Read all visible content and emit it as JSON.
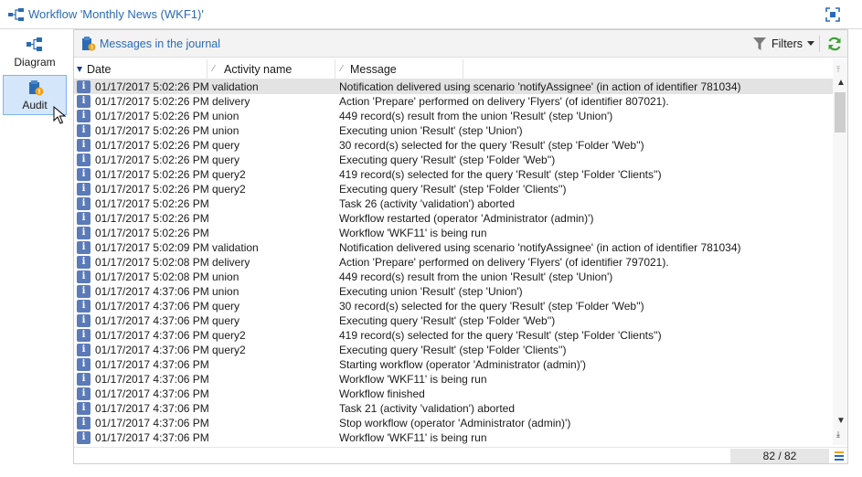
{
  "window": {
    "title": "Workflow 'Monthly News (WKF1)'",
    "icons": {
      "workflow": "workflow-icon",
      "maximize": "maximize-icon"
    }
  },
  "sidebar": {
    "items": [
      {
        "label": "Diagram",
        "icon": "diagram-icon",
        "active": false
      },
      {
        "label": "Audit",
        "icon": "audit-icon",
        "active": true
      }
    ]
  },
  "journal": {
    "title": "Messages in the journal",
    "icon": "journal-icon",
    "filters_label": "Filters",
    "refresh_icon": "refresh-icon"
  },
  "table": {
    "columns": [
      "Date",
      "Activity name",
      "Message"
    ],
    "sort_column": "Date",
    "rows": [
      {
        "date": "01/17/2017 5:02:26 PM",
        "activity": "validation",
        "message": "Notification delivered using scenario 'notifyAssignee' (in action of identifier 781034)"
      },
      {
        "date": "01/17/2017 5:02:26 PM",
        "activity": "delivery",
        "message": "Action 'Prepare' performed on delivery 'Flyers' (of identifier 807021)."
      },
      {
        "date": "01/17/2017 5:02:26 PM",
        "activity": "union",
        "message": "449 record(s) result from the union 'Result' (step 'Union')"
      },
      {
        "date": "01/17/2017 5:02:26 PM",
        "activity": "union",
        "message": "Executing union 'Result' (step 'Union')"
      },
      {
        "date": "01/17/2017 5:02:26 PM",
        "activity": "query",
        "message": "30 record(s) selected for the query 'Result' (step 'Folder 'Web'')"
      },
      {
        "date": "01/17/2017 5:02:26 PM",
        "activity": "query",
        "message": "Executing query 'Result' (step 'Folder 'Web'')"
      },
      {
        "date": "01/17/2017 5:02:26 PM",
        "activity": "query2",
        "message": "419 record(s) selected for the query 'Result' (step 'Folder 'Clients'')"
      },
      {
        "date": "01/17/2017 5:02:26 PM",
        "activity": "query2",
        "message": "Executing query 'Result' (step 'Folder 'Clients'')"
      },
      {
        "date": "01/17/2017 5:02:26 PM",
        "activity": "",
        "message": "Task 26 (activity 'validation') aborted"
      },
      {
        "date": "01/17/2017 5:02:26 PM",
        "activity": "",
        "message": "Workflow restarted (operator 'Administrator (admin)')"
      },
      {
        "date": "01/17/2017 5:02:26 PM",
        "activity": "",
        "message": "Workflow 'WKF11' is being run"
      },
      {
        "date": "01/17/2017 5:02:09 PM",
        "activity": "validation",
        "message": "Notification delivered using scenario 'notifyAssignee' (in action of identifier 781034)"
      },
      {
        "date": "01/17/2017 5:02:08 PM",
        "activity": "delivery",
        "message": "Action 'Prepare' performed on delivery 'Flyers' (of identifier 797021)."
      },
      {
        "date": "01/17/2017 5:02:08 PM",
        "activity": "union",
        "message": "449 record(s) result from the union 'Result' (step 'Union')"
      },
      {
        "date": "01/17/2017 4:37:06 PM",
        "activity": "union",
        "message": "Executing union 'Result' (step 'Union')"
      },
      {
        "date": "01/17/2017 4:37:06 PM",
        "activity": "query",
        "message": "30 record(s) selected for the query 'Result' (step 'Folder 'Web'')"
      },
      {
        "date": "01/17/2017 4:37:06 PM",
        "activity": "query",
        "message": "Executing query 'Result' (step 'Folder 'Web'')"
      },
      {
        "date": "01/17/2017 4:37:06 PM",
        "activity": "query2",
        "message": "419 record(s) selected for the query 'Result' (step 'Folder 'Clients'')"
      },
      {
        "date": "01/17/2017 4:37:06 PM",
        "activity": "query2",
        "message": "Executing query 'Result' (step 'Folder 'Clients'')"
      },
      {
        "date": "01/17/2017 4:37:06 PM",
        "activity": "",
        "message": "Starting workflow (operator 'Administrator (admin)')"
      },
      {
        "date": "01/17/2017 4:37:06 PM",
        "activity": "",
        "message": "Workflow 'WKF11' is being run"
      },
      {
        "date": "01/17/2017 4:37:06 PM",
        "activity": "",
        "message": "Workflow finished"
      },
      {
        "date": "01/17/2017 4:37:06 PM",
        "activity": "",
        "message": "Task 21 (activity 'validation') aborted"
      },
      {
        "date": "01/17/2017 4:37:06 PM",
        "activity": "",
        "message": "Stop workflow (operator 'Administrator (admin)')"
      },
      {
        "date": "01/17/2017 4:37:06 PM",
        "activity": "",
        "message": "Workflow 'WKF11' is being run"
      }
    ]
  },
  "status": {
    "count": "82 / 82"
  },
  "colors": {
    "accent": "#2a6bb5",
    "selected_tab": "#d4e6fa",
    "info_icon": "#5b7ab8",
    "refresh": "#3aa335"
  }
}
